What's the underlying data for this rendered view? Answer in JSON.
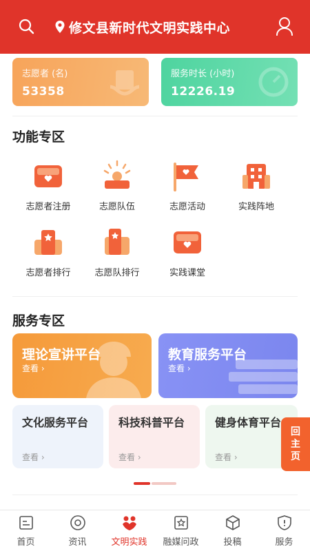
{
  "header": {
    "title": "修文县新时代文明实践中心",
    "color": "#e0342a"
  },
  "stats": {
    "volunteers": {
      "label": "志愿者 (名)",
      "value": "53358"
    },
    "hours": {
      "label": "服务时长 (小时)",
      "value": "12226.19"
    }
  },
  "functions": {
    "title": "功能专区",
    "items": [
      {
        "label": "志愿者注册",
        "icon": "id-card-icon"
      },
      {
        "label": "志愿队伍",
        "icon": "team-icon"
      },
      {
        "label": "志愿活动",
        "icon": "flag-icon"
      },
      {
        "label": "实践阵地",
        "icon": "building-icon"
      },
      {
        "label": "志愿者排行",
        "icon": "ranking-icon"
      },
      {
        "label": "志愿队排行",
        "icon": "team-ranking-icon"
      },
      {
        "label": "实践课堂",
        "icon": "classroom-icon"
      }
    ]
  },
  "services": {
    "title": "服务专区",
    "more_label": "查看",
    "cards": [
      {
        "title": "理论宣讲平台"
      },
      {
        "title": "教育服务平台"
      },
      {
        "title": "文化服务平台"
      },
      {
        "title": "科技科普平台"
      },
      {
        "title": "健身体育平台"
      }
    ]
  },
  "float_home": {
    "line1": "回",
    "line2": "主",
    "line3": "页"
  },
  "tabs": [
    {
      "label": "首页",
      "icon": "home-icon"
    },
    {
      "label": "资讯",
      "icon": "news-icon"
    },
    {
      "label": "文明实践",
      "icon": "civilization-icon",
      "active": true
    },
    {
      "label": "融媒问政",
      "icon": "star-badge-icon"
    },
    {
      "label": "投稿",
      "icon": "box-icon"
    },
    {
      "label": "服务",
      "icon": "service-shield-icon"
    }
  ]
}
